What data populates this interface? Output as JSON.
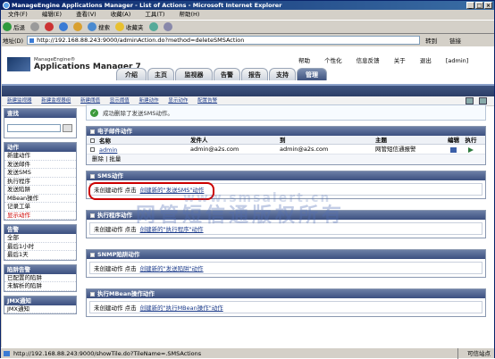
{
  "window": {
    "title": "ManageEngine Applications Manager - List of Actions - Microsoft Internet Explorer",
    "buttons": [
      "_",
      "□",
      "×"
    ]
  },
  "menu": [
    "文件(F)",
    "编辑(E)",
    "查看(V)",
    "收藏(A)",
    "工具(T)",
    "帮助(H)"
  ],
  "toolbar": {
    "back": "后退",
    "search": "搜索",
    "favorites": "收藏夹"
  },
  "address": {
    "label": "地址(D)",
    "url": "http://192.168.88.243:9000/adminAction.do?method=deleteSMSAction",
    "go": "转到",
    "links": "链接"
  },
  "header": {
    "brand_small": "ManageEngine®",
    "brand_big": "Applications Manager 7",
    "links": [
      "帮助",
      "个性化",
      "信息反馈",
      "关于",
      "退出",
      "[admin]"
    ]
  },
  "tabs": [
    "介绍",
    "主页",
    "监视器",
    "告警",
    "报告",
    "支持",
    "管理"
  ],
  "subnav": [
    "新建监视器",
    "新建监视器组",
    "新建阈值",
    "显示阈值",
    "新建动作",
    "显示动作",
    "配置告警"
  ],
  "sidebar": {
    "search_title": "查找",
    "actions_title": "动作",
    "actions": [
      "新建动作",
      "发送邮件",
      "发送SMS",
      "执行程序",
      "发送陷阱",
      "MBean操作",
      "记录工单",
      "显示动作"
    ],
    "alarms_title": "告警",
    "alarms": [
      "全部",
      "最后1小时",
      "最后1天"
    ],
    "trap_title": "陷阱告警",
    "traps": [
      "已配置的陷阱",
      "未解析的陷阱"
    ],
    "jmx_title": "JMX通知",
    "jmx": [
      "JMX通知"
    ]
  },
  "main": {
    "success": "成功删除了发送SMS动作。",
    "email_panel": {
      "title": "电子邮件动作",
      "headers": [
        "名称",
        "发件人",
        "到",
        "主题",
        "编辑",
        "执行"
      ],
      "rows": [
        {
          "name": "admin",
          "from": "admin@a2s.com",
          "to": "admin@a2s.com",
          "subject": "网管短信通报警"
        }
      ],
      "footer": "删除 | 批量"
    },
    "sms_panel": {
      "title": "SMS动作",
      "empty": "未创建动作 点击",
      "link": "创建新的\"发送SMS\"动作"
    },
    "exec_panel": {
      "title": "执行程序动作",
      "empty": "未创建动作 点击",
      "link": "创建新的\"执行程序\"动作"
    },
    "trap_panel": {
      "title": "SNMP陷阱动作",
      "empty": "未创建动作 点击",
      "link": "创建新的\"发送陷阱\"动作"
    },
    "mbean_panel": {
      "title": "执行MBean操作动作",
      "empty": "未创建动作 点击",
      "link": "创建新的\"执行MBean操作\"动作"
    }
  },
  "watermark": {
    "line1": "www.smsalert.cn",
    "line2": "网管短信通版权所有"
  },
  "status": {
    "url": "http://192.168.88.243:9000/showTile.do?TileName=.SMSActions",
    "zone": "可信站点"
  }
}
